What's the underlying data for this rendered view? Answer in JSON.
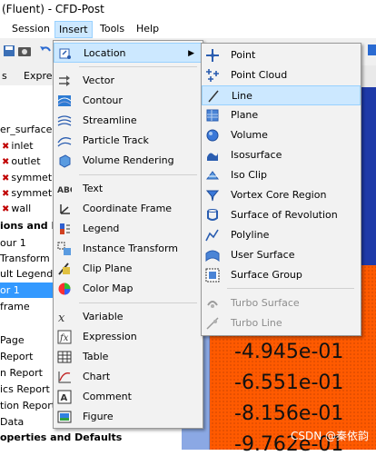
{
  "window": {
    "title": "(Fluent) - CFD-Post"
  },
  "menubar": [
    "Session",
    "Insert",
    "Tools",
    "Help"
  ],
  "left_tabs": [
    "s",
    "Expres"
  ],
  "tree": [
    {
      "label": "er_surface",
      "kind": "plain"
    },
    {
      "label": "inlet",
      "kind": "x"
    },
    {
      "label": "outlet",
      "kind": "x"
    },
    {
      "label": "symmetr",
      "kind": "x"
    },
    {
      "label": "symmetr",
      "kind": "x"
    },
    {
      "label": "wall",
      "kind": "x"
    },
    {
      "label": "ions and Pl",
      "kind": "bold"
    },
    {
      "label": "our 1",
      "kind": "plain"
    },
    {
      "label": "Transform",
      "kind": "plain"
    },
    {
      "label": "ult Legend V",
      "kind": "plain"
    },
    {
      "label": "or 1",
      "kind": "selected"
    },
    {
      "label": "frame",
      "kind": "plain"
    },
    {
      "label": "Page",
      "kind": "plain"
    },
    {
      "label": "Report",
      "kind": "plain"
    },
    {
      "label": "n Report",
      "kind": "plain"
    },
    {
      "label": "ics Report",
      "kind": "plain"
    },
    {
      "label": "tion Report",
      "kind": "plain"
    },
    {
      "label": "Data",
      "kind": "plain"
    }
  ],
  "tree_footer": "operties and Defaults",
  "insert_menu": {
    "groups": [
      [
        {
          "label": "Location",
          "icon": "location-icon",
          "submenu": true,
          "highlight": true
        }
      ],
      [
        {
          "label": "Vector",
          "icon": "vector-icon"
        },
        {
          "label": "Contour",
          "icon": "contour-icon"
        },
        {
          "label": "Streamline",
          "icon": "streamline-icon"
        },
        {
          "label": "Particle Track",
          "icon": "particle-track-icon"
        },
        {
          "label": "Volume Rendering",
          "icon": "volume-rendering-icon"
        }
      ],
      [
        {
          "label": "Text",
          "icon": "text-icon"
        },
        {
          "label": "Coordinate Frame",
          "icon": "coordinate-frame-icon"
        },
        {
          "label": "Legend",
          "icon": "legend-icon"
        },
        {
          "label": "Instance Transform",
          "icon": "instance-transform-icon"
        },
        {
          "label": "Clip Plane",
          "icon": "clip-plane-icon"
        },
        {
          "label": "Color Map",
          "icon": "color-map-icon"
        }
      ],
      [
        {
          "label": "Variable",
          "icon": "variable-icon"
        },
        {
          "label": "Expression",
          "icon": "expression-icon"
        },
        {
          "label": "Table",
          "icon": "table-icon"
        },
        {
          "label": "Chart",
          "icon": "chart-icon"
        },
        {
          "label": "Comment",
          "icon": "comment-icon"
        },
        {
          "label": "Figure",
          "icon": "figure-icon"
        }
      ]
    ]
  },
  "location_menu": [
    {
      "label": "Point",
      "icon": "point-icon"
    },
    {
      "label": "Point Cloud",
      "icon": "point-cloud-icon"
    },
    {
      "label": "Line",
      "icon": "line-icon",
      "highlight": true
    },
    {
      "label": "Plane",
      "icon": "plane-icon"
    },
    {
      "label": "Volume",
      "icon": "volume-icon"
    },
    {
      "label": "Isosurface",
      "icon": "isosurface-icon"
    },
    {
      "label": "Iso Clip",
      "icon": "iso-clip-icon"
    },
    {
      "label": "Vortex Core Region",
      "icon": "vortex-core-icon"
    },
    {
      "label": "Surface of Revolution",
      "icon": "surface-revolution-icon"
    },
    {
      "label": "Polyline",
      "icon": "polyline-icon"
    },
    {
      "label": "User Surface",
      "icon": "user-surface-icon"
    },
    {
      "label": "Surface Group",
      "icon": "surface-group-icon"
    },
    {
      "label": "Turbo Surface",
      "icon": "turbo-surface-icon",
      "disabled": true
    },
    {
      "label": "Turbo Line",
      "icon": "turbo-line-icon",
      "disabled": true
    }
  ],
  "legend_values": [
    "-4.945e-01",
    "-6.551e-01",
    "-8.156e-01",
    "-9.762e-01"
  ],
  "watermark": "CSDN @秦依韵"
}
